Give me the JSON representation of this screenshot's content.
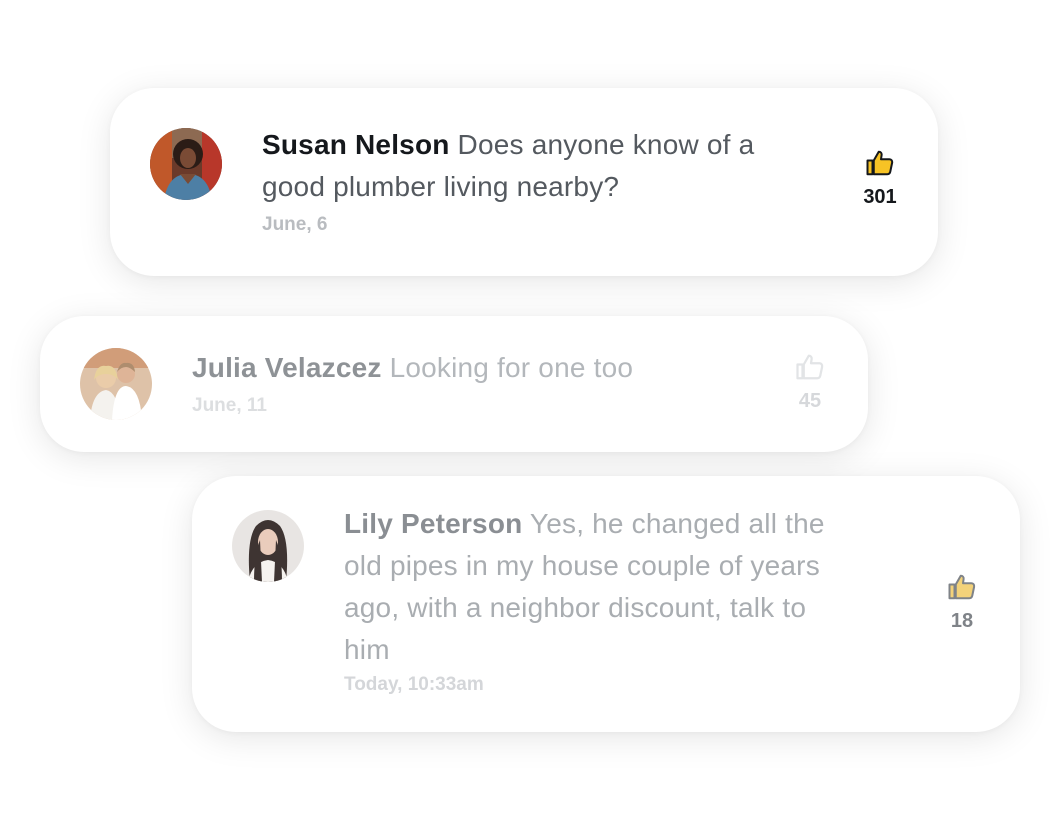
{
  "comments": [
    {
      "author": "Susan Nelson",
      "text": "Does anyone know of a good plumber living nearby?",
      "date": "June, 6",
      "likes": "301",
      "avatar_icon": "avatar-woman-city",
      "like_icon": "thumbs-up-icon",
      "like_color": "#f7c325"
    },
    {
      "author": "Julia Velazcez",
      "text": "Looking for one too",
      "date": "June, 11",
      "likes": "45",
      "avatar_icon": "avatar-couple",
      "like_icon": "thumbs-up-outline-icon",
      "like_color": "#e2e4e6"
    },
    {
      "author": "Lily Peterson",
      "text": "Yes, he changed all the old pipes in my house couple of years ago, with a neighbor discount, talk to him",
      "date": "Today, 10:33am",
      "likes": "18",
      "avatar_icon": "avatar-woman-dark-hair",
      "like_icon": "thumbs-up-icon",
      "like_color": "#f3d27a"
    }
  ]
}
